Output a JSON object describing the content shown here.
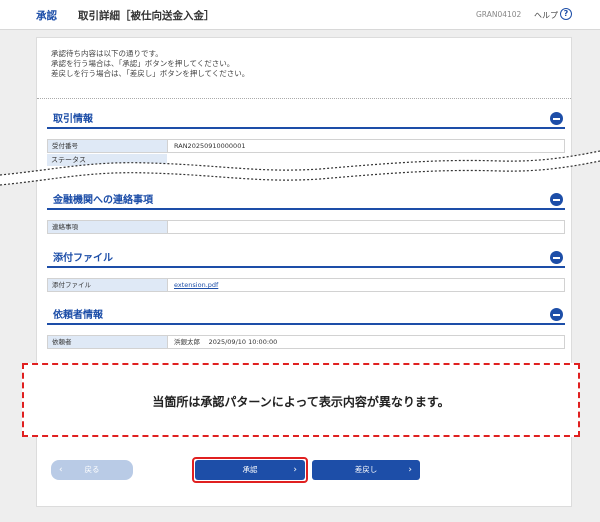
{
  "header": {
    "breadcrumb_main": "承認",
    "breadcrumb_title": "取引詳細［被仕向送金入金］",
    "screen_id": "GRAN04102",
    "help_label": "ヘルプ",
    "help_icon": "?"
  },
  "instructions": [
    "承認待ち内容は以下の通りです。",
    "承認を行う場合は、「承認」ボタンを押してください。",
    "差戻しを行う場合は、「差戻し」ボタンを押してください。"
  ],
  "sections": {
    "transaction_info": {
      "title": "取引情報",
      "receipt_label": "受付番号",
      "receipt_value": "RAN20250910000001",
      "status_label": "ステータス"
    },
    "bank_notes": {
      "title": "金融機関への連絡事項",
      "notes_label": "連絡事項",
      "notes_value": ""
    },
    "attachments": {
      "title": "添付ファイル",
      "file_label": "添付ファイル",
      "file_value": "extension.pdf"
    },
    "requester": {
      "title": "依頼者情報",
      "requester_label": "依頼者",
      "requester_value": "浜銀太郎　 2025/09/10 10:00:00"
    }
  },
  "note": "当箇所は承認パターンによって表示内容が異なります。",
  "buttons": {
    "back": "戻る",
    "approve": "承認",
    "reject": "差戻し"
  },
  "colors": {
    "accent": "#1d4ea8",
    "highlight": "#e02020",
    "label_bg": "#dfe9f6"
  }
}
